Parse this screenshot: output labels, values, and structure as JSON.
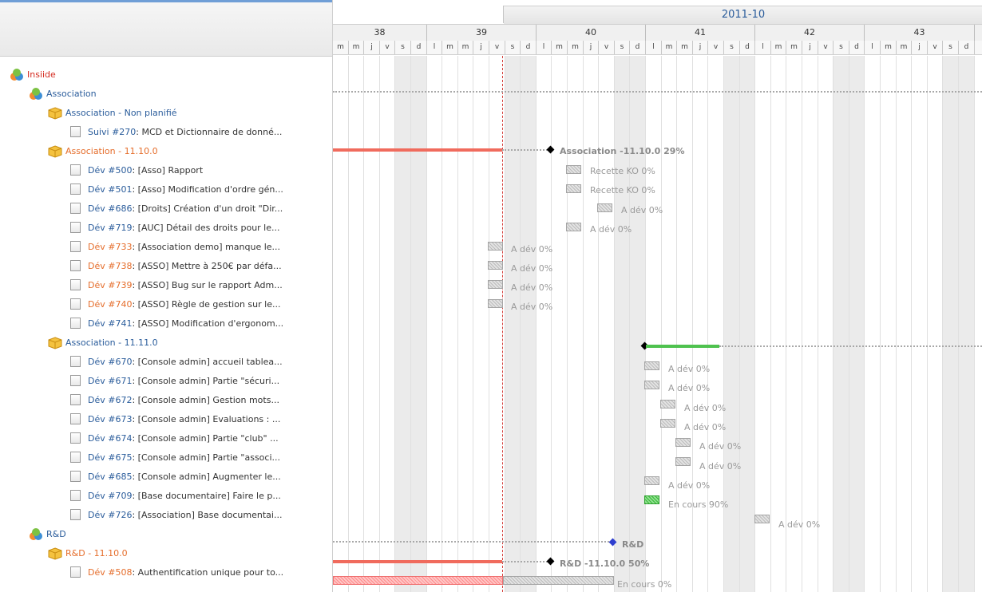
{
  "month_label": "2011-10",
  "weeks": [
    {
      "label": "38"
    },
    {
      "label": "39"
    },
    {
      "label": "40"
    },
    {
      "label": "41"
    },
    {
      "label": "42"
    },
    {
      "label": "43"
    }
  ],
  "day_letters_first": [
    "m",
    "m",
    "j",
    "v",
    "s",
    "d"
  ],
  "day_letters": [
    "l",
    "m",
    "m",
    "j",
    "v",
    "s",
    "d"
  ],
  "tree": [
    {
      "level": 0,
      "icon": "project",
      "text": "Insiide",
      "cls": "red"
    },
    {
      "level": 1,
      "icon": "project",
      "text": "Association",
      "cls": "blue"
    },
    {
      "level": 2,
      "icon": "version",
      "text": "Association - Non planifié",
      "cls": "blue"
    },
    {
      "level": 3,
      "icon": "issue",
      "id": "Suivi #270",
      "rest": ": MCD et Dictionnaire de donné...",
      "idcls": "blue"
    },
    {
      "level": 2,
      "icon": "version",
      "text": "Association - 11.10.0",
      "cls": "orange"
    },
    {
      "level": 3,
      "icon": "issue",
      "id": "Dév #500",
      "rest": ": [Asso] Rapport",
      "idcls": "blue"
    },
    {
      "level": 3,
      "icon": "issue",
      "id": "Dév #501",
      "rest": ": [Asso] Modification d'ordre gén...",
      "idcls": "blue"
    },
    {
      "level": 3,
      "icon": "issue",
      "id": "Dév #686",
      "rest": ": [Droits] Création d'un droit \"Dir...",
      "idcls": "blue"
    },
    {
      "level": 3,
      "icon": "issue",
      "id": "Dév #719",
      "rest": ": [AUC] Détail des droits pour le...",
      "idcls": "blue"
    },
    {
      "level": 3,
      "icon": "issue",
      "id": "Dév #733",
      "rest": ": [Association demo] manque le...",
      "idcls": "orange"
    },
    {
      "level": 3,
      "icon": "issue",
      "id": "Dév #738",
      "rest": ": [ASSO] Mettre à 250€ par défa...",
      "idcls": "orange"
    },
    {
      "level": 3,
      "icon": "issue",
      "id": "Dév #739",
      "rest": ": [ASSO] Bug sur le rapport Adm...",
      "idcls": "orange"
    },
    {
      "level": 3,
      "icon": "issue",
      "id": "Dév #740",
      "rest": ": [ASSO] Règle de gestion sur le...",
      "idcls": "orange"
    },
    {
      "level": 3,
      "icon": "issue",
      "id": "Dév #741",
      "rest": ": [ASSO] Modification d'ergonom...",
      "idcls": "blue"
    },
    {
      "level": 2,
      "icon": "version",
      "text": "Association - 11.11.0",
      "cls": "blue"
    },
    {
      "level": 3,
      "icon": "issue",
      "id": "Dév #670",
      "rest": ": [Console admin] accueil tablea...",
      "idcls": "blue"
    },
    {
      "level": 3,
      "icon": "issue",
      "id": "Dév #671",
      "rest": ": [Console admin] Partie \"sécuri...",
      "idcls": "blue"
    },
    {
      "level": 3,
      "icon": "issue",
      "id": "Dév #672",
      "rest": ": [Console admin] Gestion mots...",
      "idcls": "blue"
    },
    {
      "level": 3,
      "icon": "issue",
      "id": "Dév #673",
      "rest": ": [Console admin] Evaluations : ...",
      "idcls": "blue"
    },
    {
      "level": 3,
      "icon": "issue",
      "id": "Dév #674",
      "rest": ": [Console admin] Partie \"club\" ...",
      "idcls": "blue"
    },
    {
      "level": 3,
      "icon": "issue",
      "id": "Dév #675",
      "rest": ": [Console admin] Partie \"associ...",
      "idcls": "blue"
    },
    {
      "level": 3,
      "icon": "issue",
      "id": "Dév #685",
      "rest": ": [Console admin] Augmenter le...",
      "idcls": "blue"
    },
    {
      "level": 3,
      "icon": "issue",
      "id": "Dév #709",
      "rest": ": [Base documentaire] Faire le p...",
      "idcls": "blue"
    },
    {
      "level": 3,
      "icon": "issue",
      "id": "Dév #726",
      "rest": ": [Association] Base documentai...",
      "idcls": "blue"
    },
    {
      "level": 1,
      "icon": "project",
      "text": "R&D",
      "cls": "blue"
    },
    {
      "level": 2,
      "icon": "version",
      "text": "R&D - 11.10.0",
      "cls": "orange"
    },
    {
      "level": 3,
      "icon": "issue",
      "id": "Dév #508",
      "rest": ": Authentification unique pour to...",
      "idcls": "orange"
    }
  ],
  "gantt_labels": {
    "asso_1110": "Association -11.10.0 29%",
    "recette_ko": "Recette KO 0%",
    "a_dev": "A dév 0%",
    "en_cours_90": "En cours 90%",
    "rd": "R&D",
    "rd_1110": "R&D -11.10.0 50%",
    "en_cours_0": "En cours 0%"
  },
  "colors": {
    "accent": "#2a5c9b",
    "late": "#f06b5d",
    "done": "#4fc24f",
    "today": "#d43f3a"
  }
}
